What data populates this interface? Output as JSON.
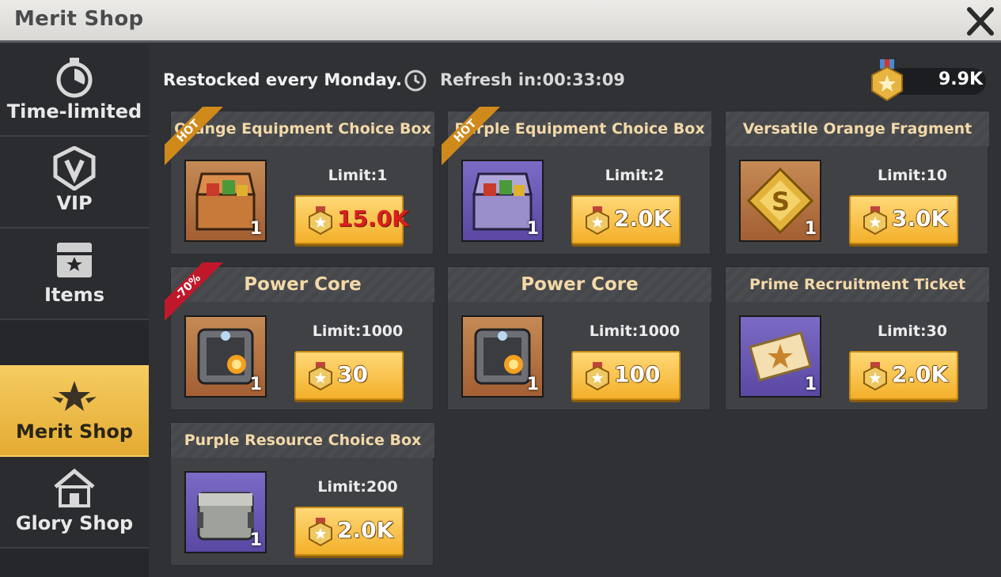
{
  "window": {
    "title": "Merit Shop"
  },
  "sidebar": {
    "items": [
      {
        "label": "Time-limited",
        "icon": "stopwatch-icon",
        "active": false
      },
      {
        "label": "VIP",
        "icon": "vip-shield-icon",
        "active": false
      },
      {
        "label": "Items",
        "icon": "item-box-icon",
        "active": false
      },
      {
        "label": "Merit Shop",
        "icon": "winged-star-icon",
        "active": true
      },
      {
        "label": "Glory Shop",
        "icon": "shop-house-icon",
        "active": false
      }
    ]
  },
  "header": {
    "restock": "Restocked every Monday.",
    "refresh": "Refresh in:00:33:09",
    "currency_amount": "9.9K"
  },
  "items": [
    {
      "name": "Orange Equipment Choice Box",
      "limit": "Limit:1",
      "price": "15.0K",
      "qty": "1",
      "bg": "orange",
      "ribbon": "HOT",
      "insufficient": true,
      "icon": "treasure-chest-icon"
    },
    {
      "name": "Purple Equipment Choice Box",
      "limit": "Limit:2",
      "price": "2.0K",
      "qty": "1",
      "bg": "purple",
      "ribbon": "HOT",
      "insufficient": false,
      "icon": "treasure-chest-icon"
    },
    {
      "name": "Versatile Orange Fragment",
      "limit": "Limit:10",
      "price": "3.0K",
      "qty": "1",
      "bg": "orange",
      "ribbon": "",
      "insufficient": false,
      "icon": "puzzle-fragment-icon"
    },
    {
      "name": "Power Core",
      "limit": "Limit:1000",
      "price": "30",
      "qty": "1",
      "bg": "orange",
      "ribbon": "-70%",
      "insufficient": false,
      "icon": "power-core-icon"
    },
    {
      "name": "Power Core",
      "limit": "Limit:1000",
      "price": "100",
      "qty": "1",
      "bg": "orange",
      "ribbon": "",
      "insufficient": false,
      "icon": "power-core-icon"
    },
    {
      "name": "Prime Recruitment Ticket",
      "limit": "Limit:30",
      "price": "2.0K",
      "qty": "1",
      "bg": "purple",
      "ribbon": "",
      "insufficient": false,
      "icon": "recruit-ticket-icon"
    },
    {
      "name": "Purple Resource Choice Box",
      "limit": "Limit:200",
      "price": "2.0K",
      "qty": "1",
      "bg": "purple",
      "ribbon": "",
      "insufficient": false,
      "icon": "resource-crate-icon"
    }
  ],
  "colors": {
    "accent": "#f3b02a",
    "active_tab": "#f6cc61",
    "hot_ribbon": "#d08a1c",
    "sale_ribbon": "#c0182a",
    "price_insufficient": "#d91f1f"
  }
}
